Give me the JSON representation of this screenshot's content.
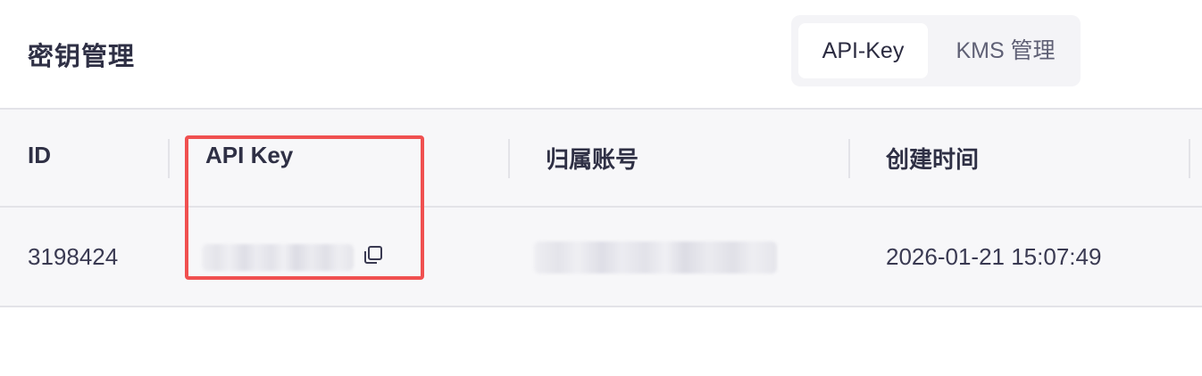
{
  "header": {
    "title": "密钥管理",
    "tabs": [
      {
        "label": "API-Key",
        "active": true
      },
      {
        "label": "KMS 管理",
        "active": false
      }
    ]
  },
  "table": {
    "columns": [
      "ID",
      "API Key",
      "归属账号",
      "创建时间"
    ],
    "rows": [
      {
        "id": "3198424",
        "api_key": "",
        "account": "",
        "created_at": "2026-01-21 15:07:49"
      }
    ]
  },
  "icons": {
    "copy": "copy-icon"
  },
  "colors": {
    "highlight": "#f05050",
    "table_bg": "#f7f7f9",
    "tab_group_bg": "#f4f4f7"
  }
}
